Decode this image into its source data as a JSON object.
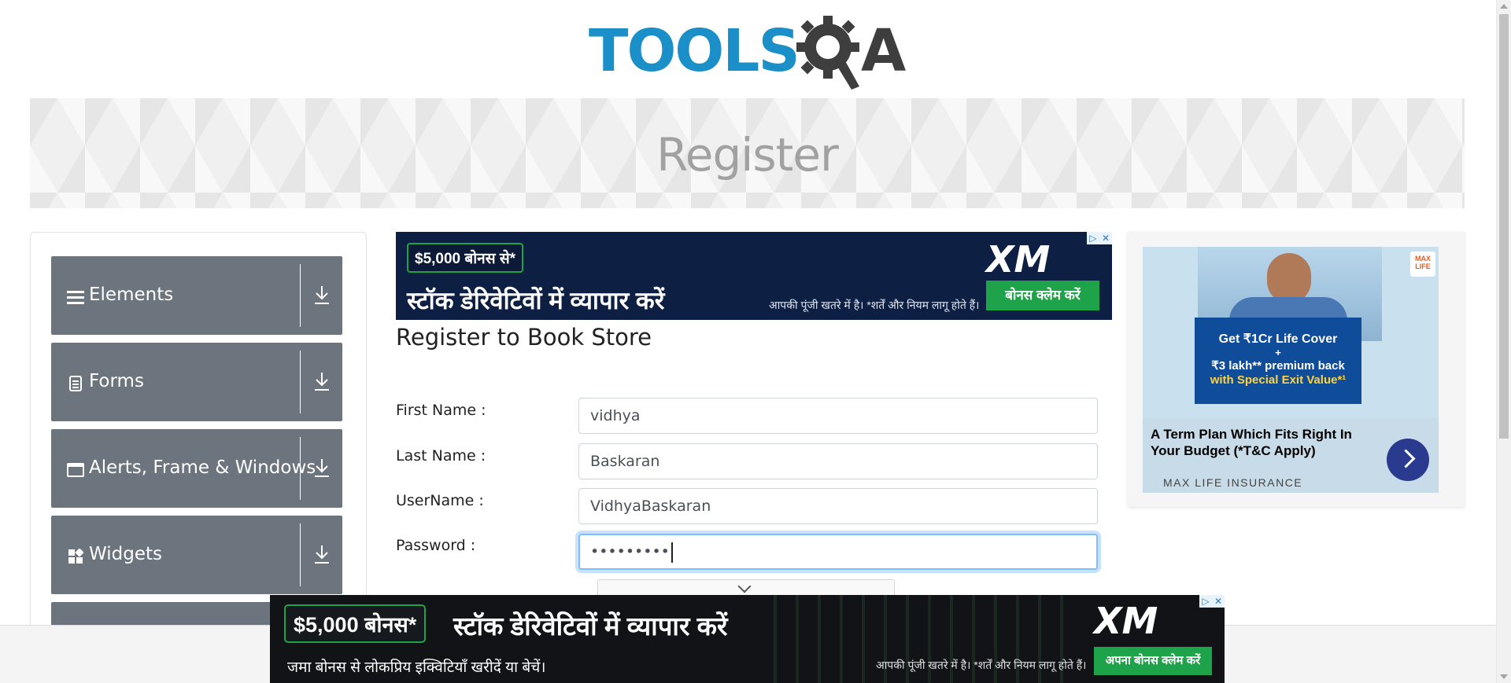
{
  "header": {
    "logo_text_part1": "TOOLS",
    "logo_text_part2": "A"
  },
  "banner": {
    "title": "Register"
  },
  "sidebar": {
    "groups": [
      {
        "label": "Elements",
        "icon": "menu-icon"
      },
      {
        "label": "Forms",
        "icon": "document-icon"
      },
      {
        "label": "Alerts, Frame & Windows",
        "icon": "window-icon"
      },
      {
        "label": "Widgets",
        "icon": "widgets-icon"
      }
    ]
  },
  "ad_top": {
    "bonus": "$5,000 बोनस से*",
    "headline": "स्टॉक डेरिवेटिवों में व्यापार करें",
    "risk": "आपकी पूंजी खतरे में है। *शर्तें और नियम लागू होते हैं।",
    "brand": "XM",
    "cta": "बोनस क्लेम करें"
  },
  "form": {
    "title": "Register to Book Store",
    "first_name": {
      "label": "First Name :",
      "value": "vidhya"
    },
    "last_name": {
      "label": "Last Name :",
      "value": "Baskaran"
    },
    "username": {
      "label": "UserName :",
      "value": "VidhyaBaskaran"
    },
    "password": {
      "label": "Password :",
      "value": "•••••••••"
    }
  },
  "ad_right": {
    "line1": "Get ₹1Cr Life Cover",
    "line2": "+",
    "line3": "₹3 lakh** premium back",
    "line4": "with Special Exit Value*¹",
    "tagline": "A Term Plan Which Fits Right In Your Budget (*T&C Apply)",
    "advertiser": "MAX LIFE INSURANCE",
    "mini_logo": "MAX LIFE"
  },
  "ad_bottom": {
    "bonus": "$5,000 बोनस*",
    "headline": "स्टॉक डेरिवेटिवों में व्यापार करें",
    "sub": "जमा बोनस से लोकप्रिय इक्विटियाँ खरीदें या बेचें।",
    "risk": "आपकी पूंजी खतरे में है। *शर्तें और नियम लागू होते हैं।",
    "brand": "XM",
    "cta": "अपना बोनस क्लेम करें"
  },
  "colors": {
    "logo_blue": "#1b8fc8",
    "logo_dark": "#3e3e3e",
    "sidebar_group_bg": "#6c757d",
    "focus_border": "#80bdff",
    "ad_green": "#1fa34a"
  }
}
